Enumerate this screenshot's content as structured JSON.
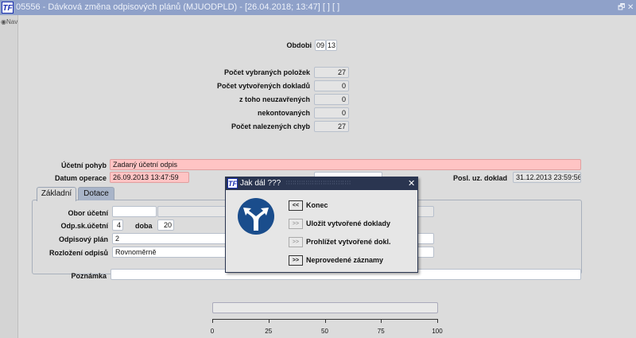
{
  "window": {
    "title": "05556 - Dávková změna odpisových plánů (MJUODPLD) - [26.04.2018; 13:47]  [ ]  [ ]",
    "logo": "TF"
  },
  "sidebar": {
    "nav_label": "Nav"
  },
  "obdobi": {
    "label": "Obdobi",
    "month": "09",
    "year": "13"
  },
  "counters": [
    {
      "label": "Počet vybraných položek",
      "value": "27"
    },
    {
      "label": "Počet vytvořených dokladů",
      "value": "0"
    },
    {
      "label": "z toho  neuzavřených",
      "value": "0"
    },
    {
      "label": "nekontovaných",
      "value": "0"
    },
    {
      "label": "Počet nalezených chyb",
      "value": "27"
    }
  ],
  "form": {
    "ucetni_pohyb_label": "Účetní pohyb",
    "ucetni_pohyb": "Zadaný účetní odpis",
    "datum_operace_label": "Datum operace",
    "datum_operace": "26.09.2013 13:47:59",
    "posl_doklad_label": "Posl. uz. doklad",
    "posl_doklad": "31.12.2013 23:59:56",
    "poznamka_label": "Poznámka",
    "poznamka": ""
  },
  "tabs": [
    {
      "label": "Základní",
      "active": true
    },
    {
      "label": "Dotace",
      "active": false
    }
  ],
  "tab_basic": {
    "obor_label": "Obor účetní",
    "obor": "",
    "odp_sk_label": "Odp.sk.účetní",
    "odp_sk": "4",
    "doba_label": "doba",
    "doba": "20",
    "plan_label": "Odpisový plán",
    "plan": "2",
    "rozlozeni_label": "Rozložení odpisů",
    "rozlozeni": "Rovnoměrně"
  },
  "progress": {
    "value": 0,
    "ticks": [
      "0",
      "25",
      "50",
      "75",
      "100"
    ]
  },
  "dialog": {
    "title": "Jak dál ???",
    "logo": "TF",
    "icon": "road-fork-sign-icon",
    "options": [
      {
        "btn": "<<",
        "label": "Konec",
        "enabled": true
      },
      {
        "btn": ">>",
        "label": "Uložit vytvořené doklady",
        "enabled": false
      },
      {
        "btn": ">>",
        "label": "Prohlížet vytvořené dokl.",
        "enabled": false
      },
      {
        "btn": ">>",
        "label": "Neprovedené záznamy",
        "enabled": true
      }
    ]
  },
  "colors": {
    "required_field": "#ffc4c4",
    "dialog_titlebar": "#2a3550",
    "sign_blue": "#1a4d8c"
  }
}
